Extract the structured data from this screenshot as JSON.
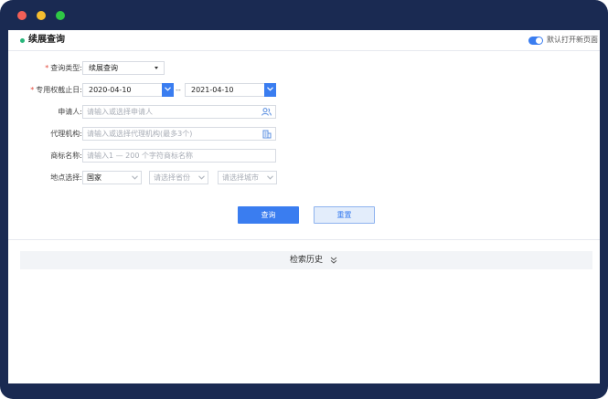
{
  "header": {
    "title": "续展查询",
    "toggle_label": "默认打开新页面"
  },
  "form": {
    "query_type": {
      "label": "查询类型:",
      "value": "续展查询"
    },
    "expiry_date": {
      "label": "专用权截止日:",
      "start": "2020-04-10",
      "separator": "--",
      "end": "2021-04-10"
    },
    "applicant": {
      "label": "申请人:",
      "placeholder": "请输入或选择申请人"
    },
    "agency": {
      "label": "代理机构:",
      "placeholder": "请输入或选择代理机构(最多3个)"
    },
    "trademark": {
      "label": "商标名称:",
      "placeholder": "请输入1 — 200 个字符商标名称"
    },
    "location": {
      "label": "地点选择:",
      "country": "国家",
      "province_placeholder": "请选择省份",
      "city_placeholder": "请选择城市"
    },
    "required_mark": "*"
  },
  "buttons": {
    "query": "查询",
    "reset": "重置"
  },
  "history": {
    "label": "检索历史"
  }
}
